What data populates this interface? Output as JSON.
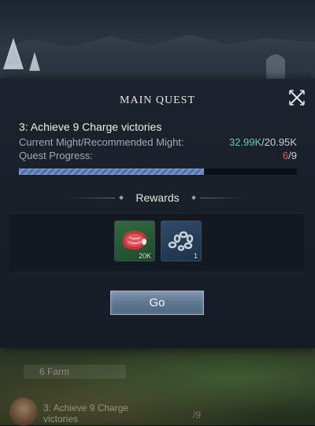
{
  "dialog": {
    "title": "MAIN QUEST",
    "quest_name": "3: Achieve 9 Charge victories",
    "might_label": "Current Might/Recommended Might:",
    "might_current": "32.99K",
    "might_separator": "/",
    "might_recommended": "20.95K",
    "progress_label": "Quest Progress:",
    "progress_current": "6",
    "progress_separator": "/",
    "progress_total": "9",
    "progress_fraction": 0.667,
    "rewards_label": "Rewards",
    "rewards": [
      {
        "icon": "meat-icon",
        "quantity": "20K"
      },
      {
        "icon": "chain-icon",
        "quantity": "1"
      }
    ],
    "go_label": "Go"
  },
  "background": {
    "farm_label": "6 Farm",
    "quest_text": "3: Achieve 9 Charge victories",
    "quest_progress": "/9"
  },
  "colors": {
    "might_current": "#5fd0a6",
    "progress_current": "#e0584e",
    "progress_fill": "#5a7db8"
  }
}
